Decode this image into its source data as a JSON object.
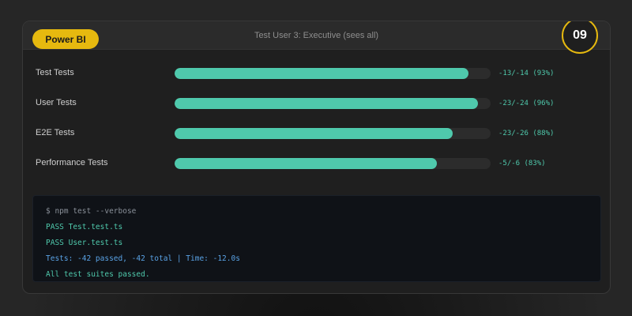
{
  "header": {
    "badge_label": "Power BI",
    "title": "Test User 3: Executive (sees all)",
    "step_number": "09"
  },
  "rows": [
    {
      "label": "Test Tests",
      "value_text": "-13/-14 (93%)",
      "progress": 93
    },
    {
      "label": "User Tests",
      "value_text": "-23/-24 (96%)",
      "progress": 96
    },
    {
      "label": "E2E Tests",
      "value_text": "-23/-26 (88%)",
      "progress": 88
    },
    {
      "label": "Performance Tests",
      "value_text": "-5/-6 (83%)",
      "progress": 83
    }
  ],
  "terminal": {
    "lines": [
      {
        "text": "$ npm test --verbose",
        "kind": "cmd"
      },
      {
        "text": "PASS Test.test.ts",
        "kind": "pass"
      },
      {
        "text": "PASS User.test.ts",
        "kind": "pass"
      },
      {
        "text": "Tests: -42 passed, -42 total | Time: -12.0s",
        "kind": "summary"
      },
      {
        "text": "All test suites passed.",
        "kind": "done"
      }
    ]
  },
  "colors": {
    "accent": "#e6b90f",
    "progress": "#4fc9ac",
    "summary": "#5aa3e6"
  }
}
